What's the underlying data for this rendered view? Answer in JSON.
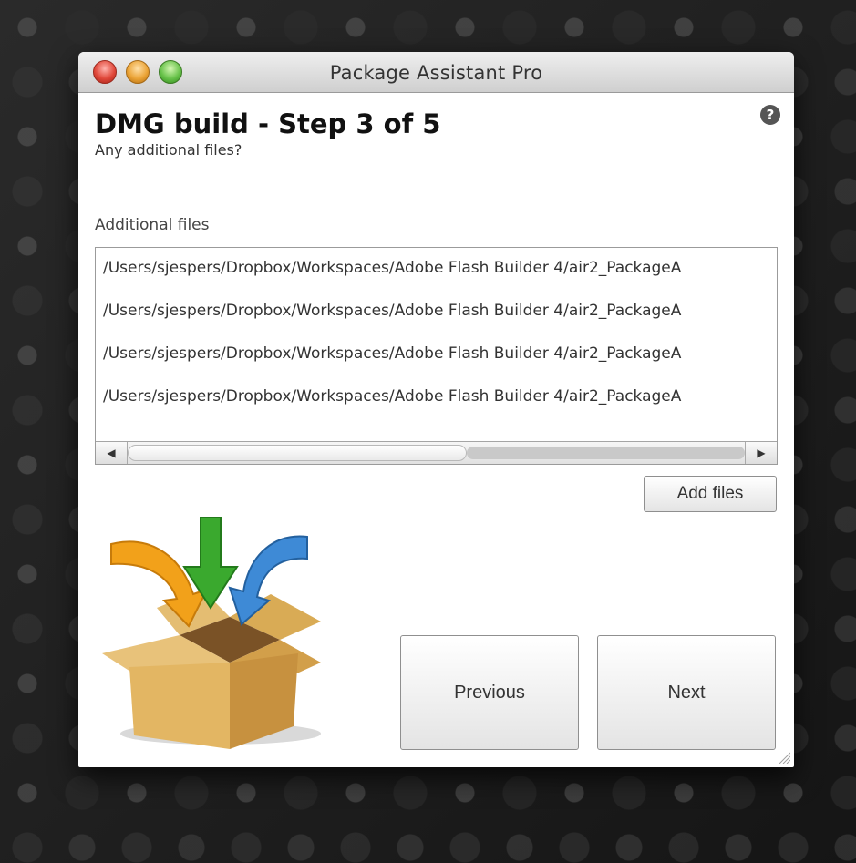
{
  "window": {
    "title": "Package Assistant Pro"
  },
  "header": {
    "title": "DMG build - Step 3 of 5",
    "subtitle": "Any additional files?",
    "help_glyph": "?"
  },
  "files": {
    "label": "Additional files",
    "rows": [
      "/Users/sjespers/Dropbox/Workspaces/Adobe Flash Builder 4/air2_PackageA",
      "/Users/sjespers/Dropbox/Workspaces/Adobe Flash Builder 4/air2_PackageA",
      "/Users/sjespers/Dropbox/Workspaces/Adobe Flash Builder 4/air2_PackageA",
      "/Users/sjespers/Dropbox/Workspaces/Adobe Flash Builder 4/air2_PackageA"
    ],
    "scroll_left_glyph": "◀",
    "scroll_right_glyph": "▶"
  },
  "buttons": {
    "add_files": "Add files",
    "previous": "Previous",
    "next": "Next"
  },
  "icons": {
    "help": "help-icon",
    "illustration": "package-box-icon",
    "arrows": [
      "orange-arrow-icon",
      "green-arrow-icon",
      "blue-arrow-icon"
    ],
    "resize": "resize-grip-icon"
  },
  "colors": {
    "arrow_orange": "#f2a11a",
    "arrow_green": "#3aa92e",
    "arrow_blue": "#3e8ad6",
    "box": "#d8aa5a"
  }
}
